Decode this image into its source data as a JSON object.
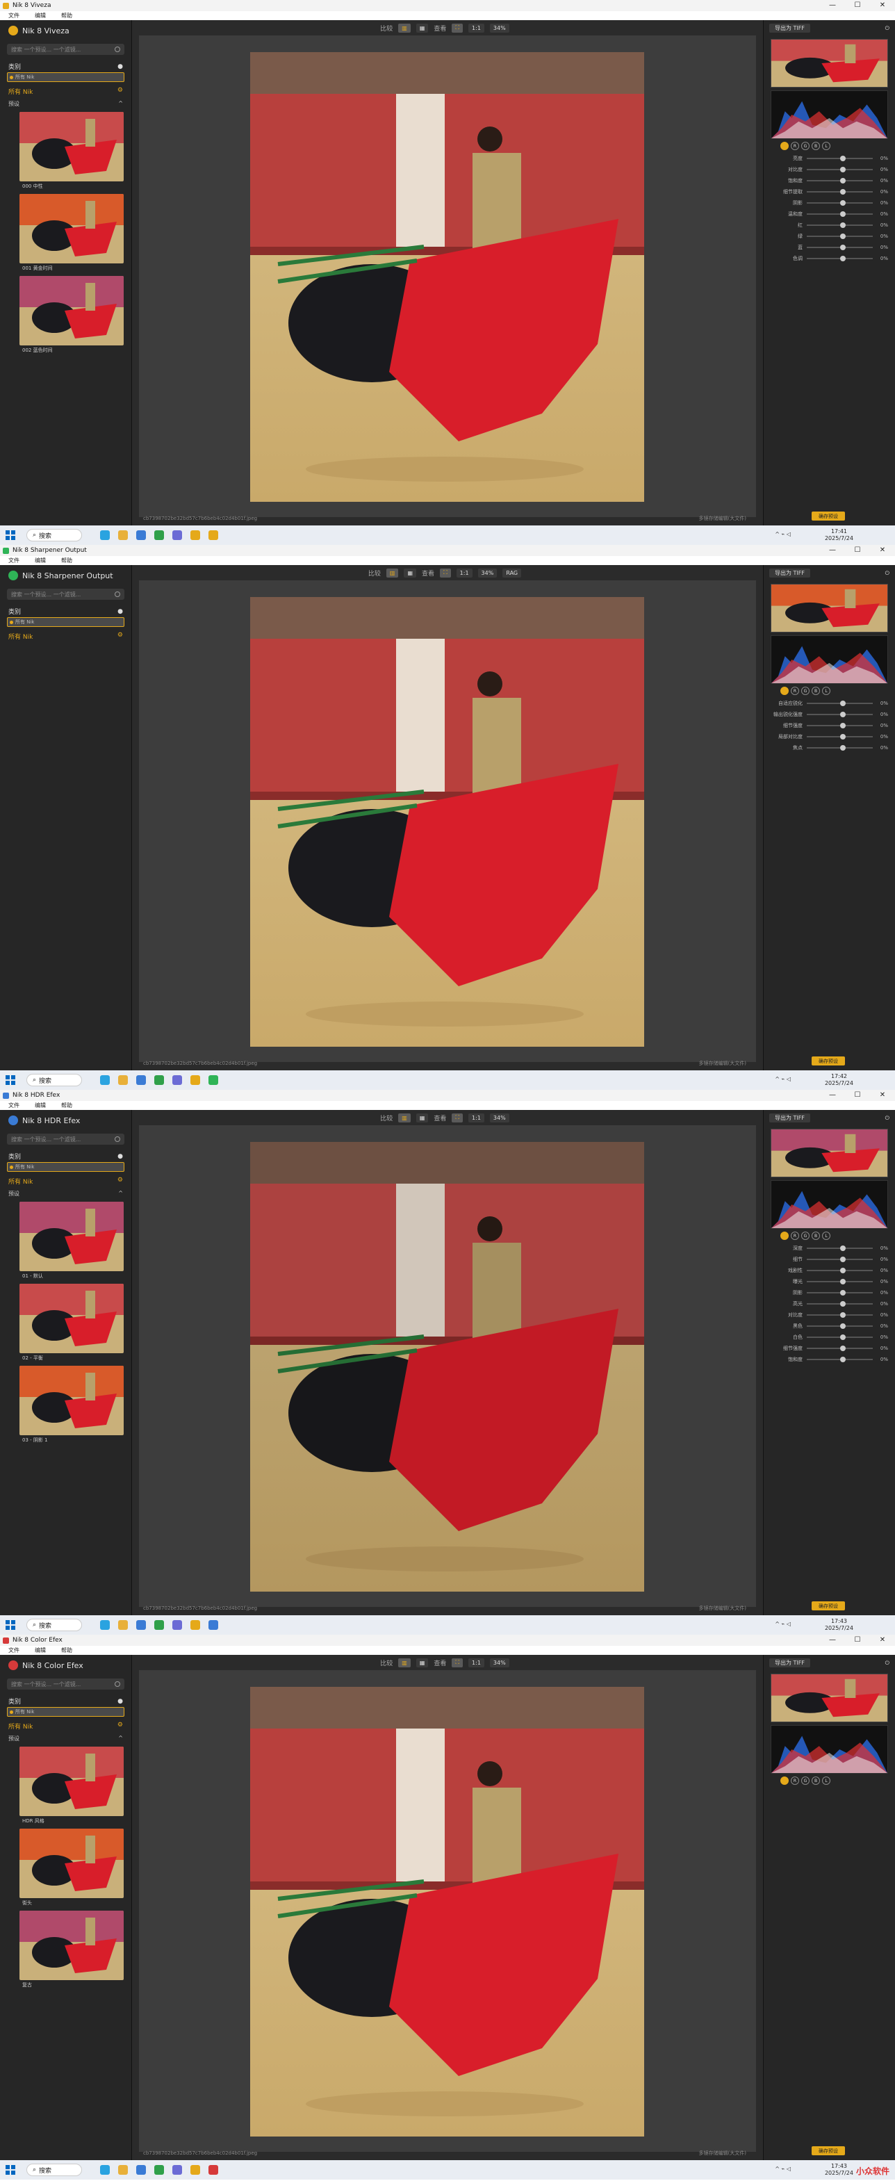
{
  "screens": [
    {
      "title": "Nik 8 Viveza",
      "brand": "Nik 8 Viveza",
      "color": "#e5a91a",
      "apply_label": "确存预设",
      "mode": "",
      "time": "17:41",
      "date": "2025/7/24",
      "thumbs": [
        "000 中性",
        "001 黄金时间",
        "002 蓝色时间"
      ],
      "sliders": [
        "亮度",
        "对比度",
        "饱和度",
        "细节提取",
        "阴影",
        "温和度",
        "红",
        "绿",
        "蓝",
        "色调"
      ]
    },
    {
      "title": "Nik 8 Sharpener Output",
      "brand": "Nik 8 Sharpener Output",
      "color": "#2fb457",
      "apply_label": "确存预设",
      "mode": "RAG",
      "time": "17:42",
      "date": "2025/7/24",
      "thumbs": [],
      "sliders": [
        "自适应锐化",
        "输出锐化强度",
        "细节强度",
        "局部对比度",
        "焦点"
      ]
    },
    {
      "title": "Nik 8 HDR Efex",
      "brand": "Nik 8 HDR Efex",
      "color": "#3a7bd5",
      "apply_label": "确存预设",
      "mode": "",
      "time": "17:43",
      "date": "2025/7/24",
      "thumbs": [
        "01 - 默认",
        "02 - 平衡",
        "03 - 阴影 1"
      ],
      "sliders": [
        "深度",
        "细节",
        "戏剧性",
        "曝光",
        "阴影",
        "高光",
        "对比度",
        "黑色",
        "白色",
        "细节强度",
        "饱和度"
      ]
    },
    {
      "title": "Nik 8 Color Efex",
      "brand": "Nik 8 Color Efex",
      "color": "#d63a3a",
      "apply_label": "确存预设",
      "mode": "",
      "time": "17:43",
      "date": "2025/7/24",
      "thumbs": [
        "HDR 风格",
        "街头",
        "复古"
      ],
      "sliders": []
    }
  ],
  "common": {
    "menu": [
      "文件",
      "编辑",
      "帮助"
    ],
    "search_placeholder": "搜索 一个预设... 一个滤镜...",
    "section": "类别",
    "all_nik": "所有 Nik",
    "presets": "预设",
    "zoom": "34%",
    "compare": "比较",
    "view": "查看",
    "save_as": "导出为 TIFF",
    "file_name": "cb7398702be32bd57c7b6beb4c02d4b01f.jpeg",
    "save_hint": "多镜存储编辑(大文件)",
    "taskbar_search": "搜索",
    "watermark": "小众软件"
  }
}
